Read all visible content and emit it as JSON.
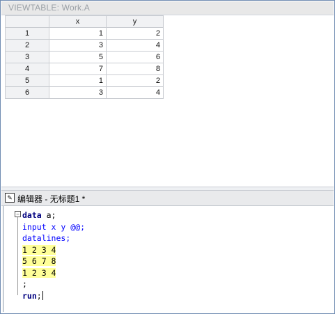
{
  "viewtable": {
    "title": "VIEWTABLE: Work.A",
    "columns": [
      "x",
      "y"
    ],
    "rows": [
      {
        "n": "1",
        "x": "1",
        "y": "2"
      },
      {
        "n": "2",
        "x": "3",
        "y": "4"
      },
      {
        "n": "3",
        "x": "5",
        "y": "6"
      },
      {
        "n": "4",
        "x": "7",
        "y": "8"
      },
      {
        "n": "5",
        "x": "1",
        "y": "2"
      },
      {
        "n": "6",
        "x": "3",
        "y": "4"
      }
    ]
  },
  "editor": {
    "title": "编辑器 - 无标题1 *",
    "icon": "sas-editor-icon",
    "fold_symbol": "−",
    "code": {
      "l1_kw": "data",
      "l1_rest": " a;",
      "l2": "input x y @@;",
      "l3": "datalines;",
      "l4": "1 2 3 4",
      "l5": "5 6 7 8",
      "l6": "1 2 3 4",
      "l7": ";",
      "l8_kw": "run",
      "l8_rest": ";"
    }
  },
  "colors": {
    "keyword": "#000080",
    "statement": "#0000ff",
    "datalines_highlight": "#ffff99"
  }
}
